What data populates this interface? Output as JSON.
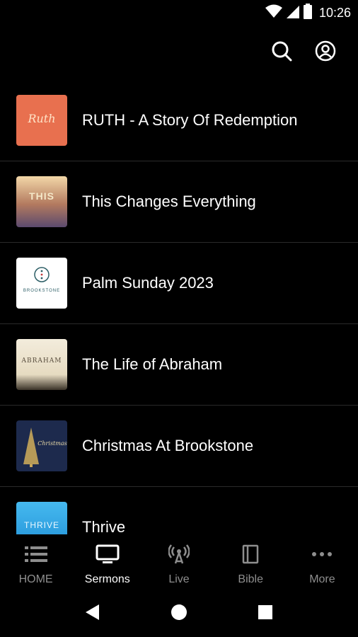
{
  "status": {
    "time": "10:26"
  },
  "app_bar": {
    "search_icon": "search-icon",
    "account_icon": "account-icon"
  },
  "sermons": [
    {
      "title": "RUTH - A Story Of Redemption",
      "thumb_text": "Ruth",
      "thumb_color": "#e8704f"
    },
    {
      "title": "This Changes Everything",
      "thumb_text": "THIS",
      "thumb_color": "#c9906a"
    },
    {
      "title": "Palm Sunday 2023",
      "thumb_text": "BROOKSTONE",
      "thumb_color": "#ffffff"
    },
    {
      "title": "The Life of Abraham",
      "thumb_text": "ABRAHAM",
      "thumb_color": "#efe7d6"
    },
    {
      "title": "Christmas At Brookstone",
      "thumb_text": "Christmas",
      "thumb_color": "#1d2a4d"
    },
    {
      "title": "Thrive",
      "thumb_text": "THRIVE",
      "thumb_color": "#2aa7e8"
    }
  ],
  "nav": [
    {
      "label": "HOME",
      "icon": "menu-icon",
      "active": false
    },
    {
      "label": "Sermons",
      "icon": "tv-icon",
      "active": true
    },
    {
      "label": "Live",
      "icon": "broadcast-icon",
      "active": false
    },
    {
      "label": "Bible",
      "icon": "book-icon",
      "active": false
    },
    {
      "label": "More",
      "icon": "more-icon",
      "active": false
    }
  ],
  "colors": {
    "background": "#000000",
    "inactive": "#8e8e8e",
    "active": "#ffffff",
    "divider": "#2a2a2a"
  }
}
